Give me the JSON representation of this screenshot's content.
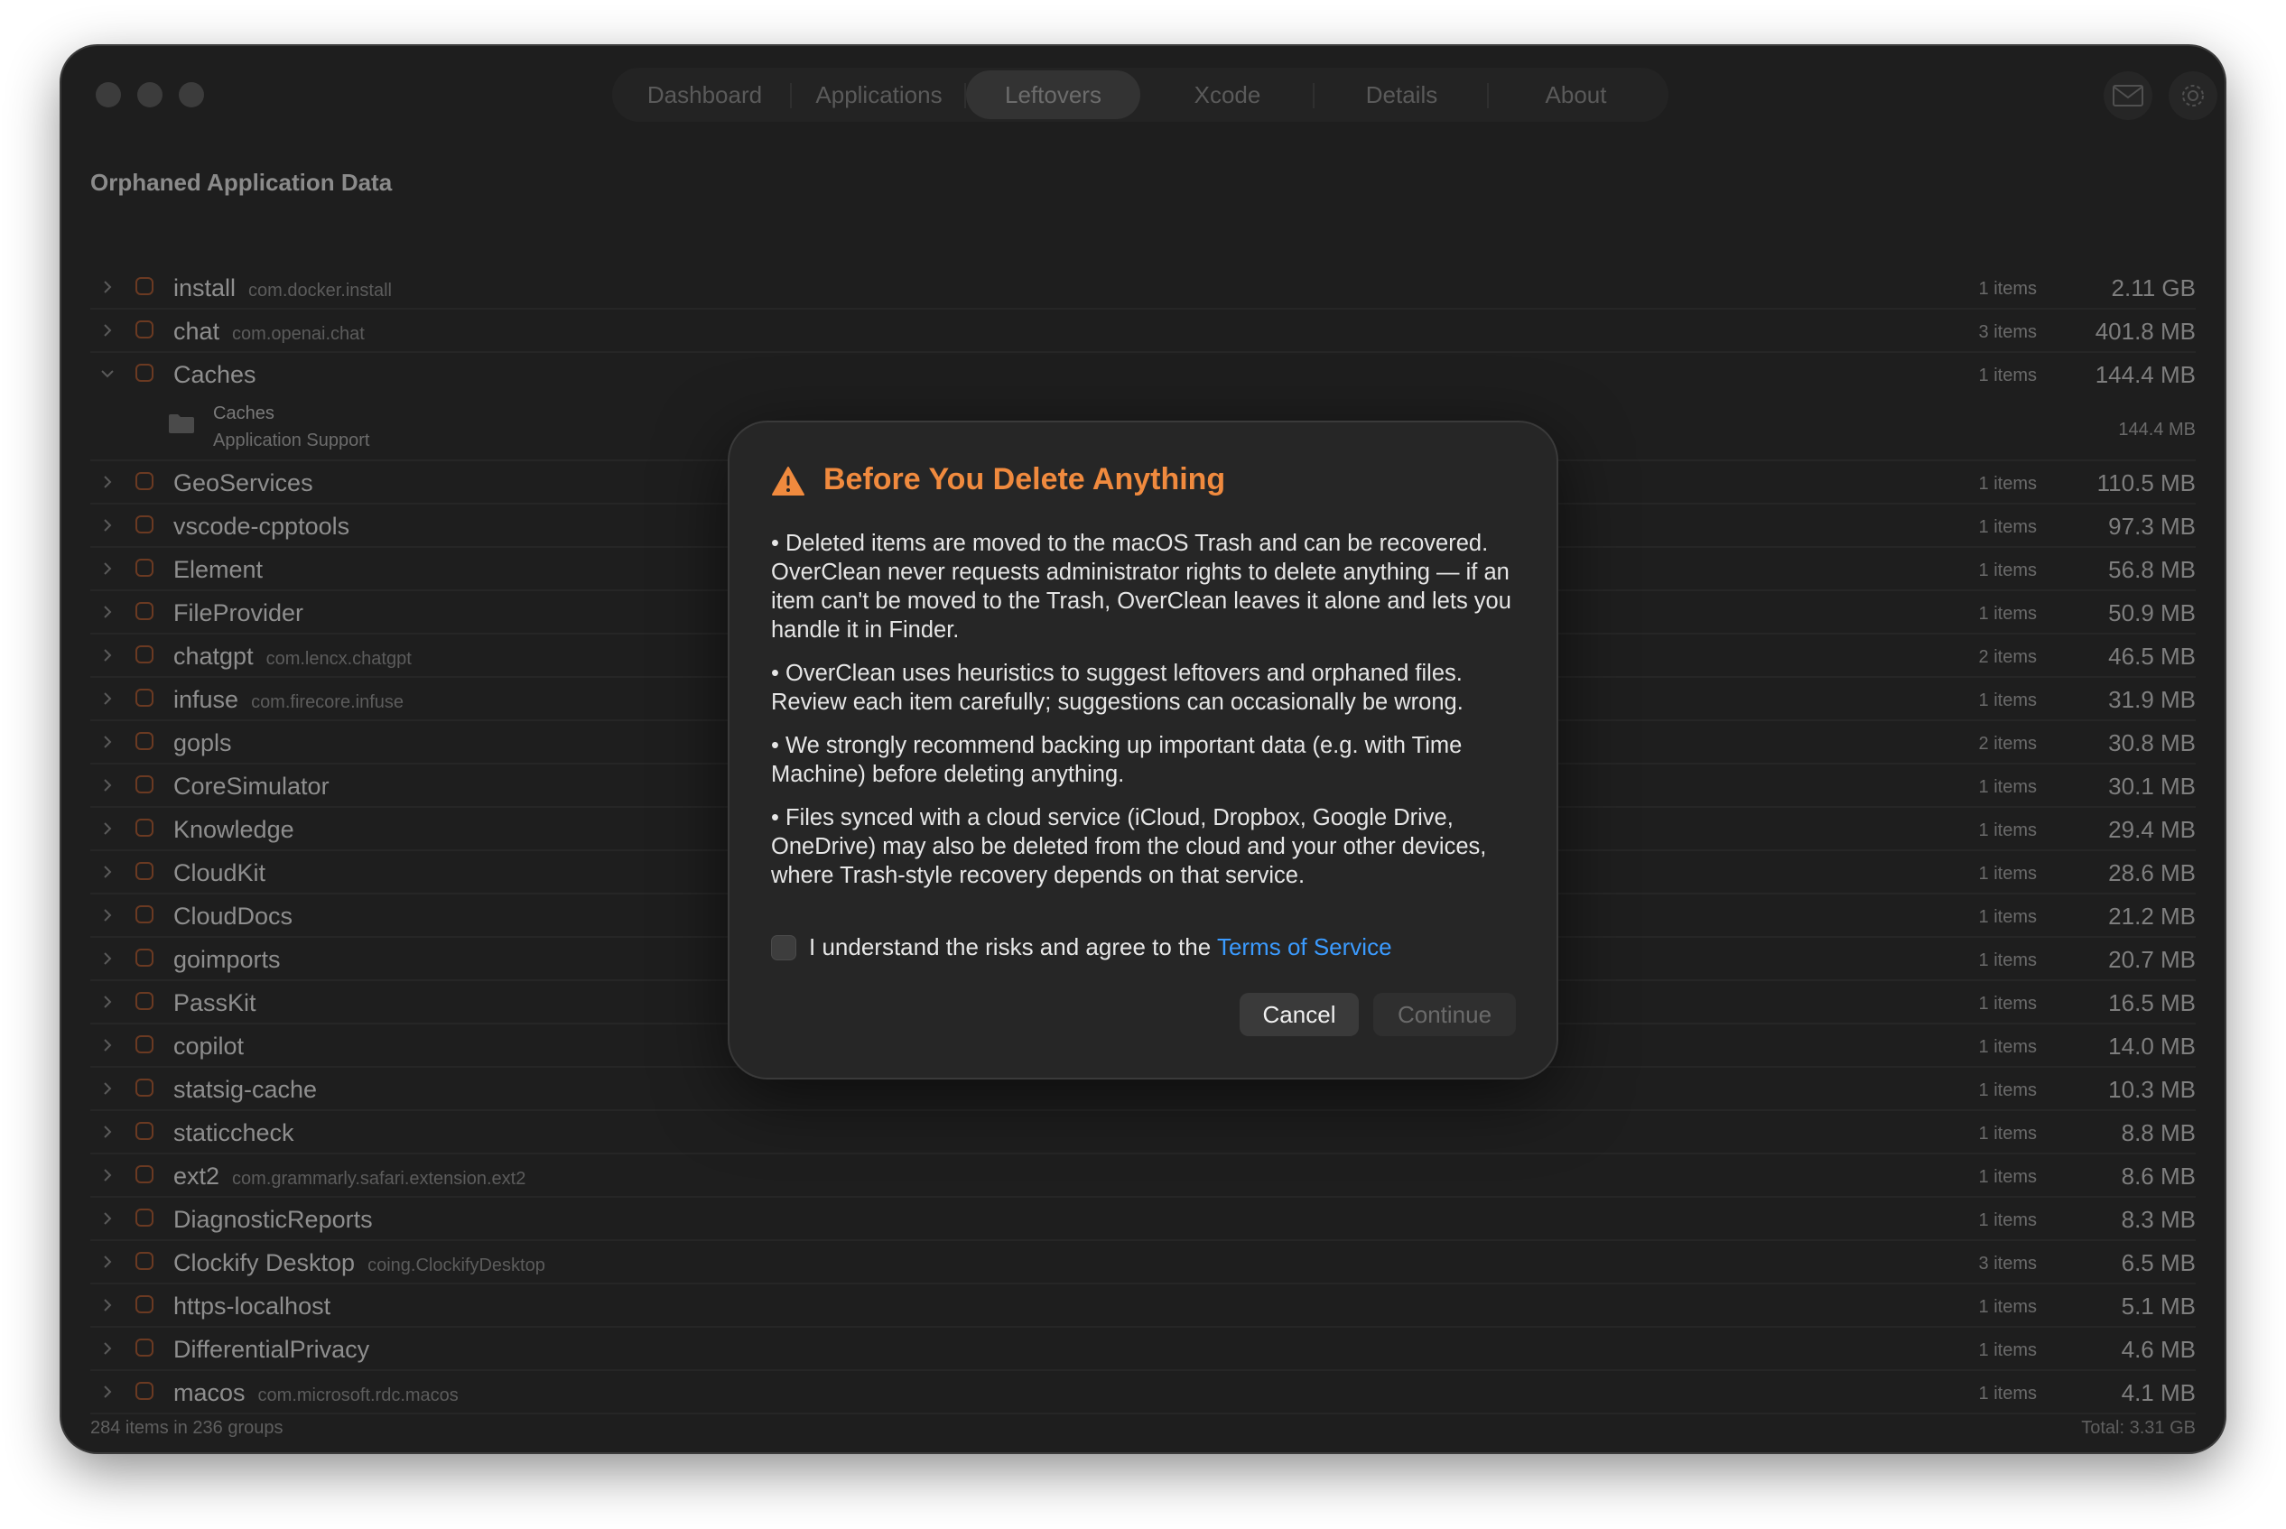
{
  "window": {
    "tabs": [
      {
        "label": "Dashboard"
      },
      {
        "label": "Applications"
      },
      {
        "label": "Leftovers"
      },
      {
        "label": "Xcode"
      },
      {
        "label": "Details"
      },
      {
        "label": "About"
      }
    ],
    "active_tab": "Leftovers",
    "header_icons": [
      "mail-icon",
      "gear-icon"
    ]
  },
  "section_title": "Orphaned Application Data",
  "rows": [
    {
      "name": "install",
      "bundle": "com.docker.install",
      "count": "1 items",
      "size": "2.11 GB"
    },
    {
      "name": "chat",
      "bundle": "com.openai.chat",
      "count": "3 items",
      "size": "401.8 MB"
    },
    {
      "name": "Caches",
      "bundle": "",
      "count": "1 items",
      "size": "144.4 MB",
      "expanded": true
    },
    {
      "name": "GeoServices",
      "bundle": "",
      "count": "1 items",
      "size": "110.5 MB"
    },
    {
      "name": "vscode-cpptools",
      "bundle": "",
      "count": "1 items",
      "size": "97.3 MB"
    },
    {
      "name": "Element",
      "bundle": "",
      "count": "1 items",
      "size": "56.8 MB"
    },
    {
      "name": "FileProvider",
      "bundle": "",
      "count": "1 items",
      "size": "50.9 MB"
    },
    {
      "name": "chatgpt",
      "bundle": "com.lencx.chatgpt",
      "count": "2 items",
      "size": "46.5 MB"
    },
    {
      "name": "infuse",
      "bundle": "com.firecore.infuse",
      "count": "1 items",
      "size": "31.9 MB"
    },
    {
      "name": "gopls",
      "bundle": "",
      "count": "2 items",
      "size": "30.8 MB"
    },
    {
      "name": "CoreSimulator",
      "bundle": "",
      "count": "1 items",
      "size": "30.1 MB"
    },
    {
      "name": "Knowledge",
      "bundle": "",
      "count": "1 items",
      "size": "29.4 MB"
    },
    {
      "name": "CloudKit",
      "bundle": "",
      "count": "1 items",
      "size": "28.6 MB"
    },
    {
      "name": "CloudDocs",
      "bundle": "",
      "count": "1 items",
      "size": "21.2 MB"
    },
    {
      "name": "goimports",
      "bundle": "",
      "count": "1 items",
      "size": "20.7 MB"
    },
    {
      "name": "PassKit",
      "bundle": "",
      "count": "1 items",
      "size": "16.5 MB"
    },
    {
      "name": "copilot",
      "bundle": "",
      "count": "1 items",
      "size": "14.0 MB"
    },
    {
      "name": "statsig-cache",
      "bundle": "",
      "count": "1 items",
      "size": "10.3 MB"
    },
    {
      "name": "staticcheck",
      "bundle": "",
      "count": "1 items",
      "size": "8.8 MB"
    },
    {
      "name": "ext2",
      "bundle": "com.grammarly.safari.extension.ext2",
      "count": "1 items",
      "size": "8.6 MB"
    },
    {
      "name": "DiagnosticReports",
      "bundle": "",
      "count": "1 items",
      "size": "8.3 MB"
    },
    {
      "name": "Clockify Desktop",
      "bundle": "coing.ClockifyDesktop",
      "count": "3 items",
      "size": "6.5 MB"
    },
    {
      "name": "https-localhost",
      "bundle": "",
      "count": "1 items",
      "size": "5.1 MB"
    },
    {
      "name": "DifferentialPrivacy",
      "bundle": "",
      "count": "1 items",
      "size": "4.6 MB"
    },
    {
      "name": "macos",
      "bundle": "com.microsoft.rdc.macos",
      "count": "1 items",
      "size": "4.1 MB"
    }
  ],
  "caches_child": {
    "name": "Caches",
    "path": "Application Support",
    "size": "144.4 MB"
  },
  "footer": {
    "summary": "284 items in 236 groups",
    "total": "Total: 3.31 GB"
  },
  "modal": {
    "title": "Before You Delete Anything",
    "bullets": [
      "• Deleted items are moved to the macOS Trash and can be recovered. OverClean never requests administrator rights to delete anything — if an item can't be moved to the Trash, OverClean leaves it alone and lets you handle it in Finder.",
      "• OverClean uses heuristics to suggest leftovers and orphaned files. Review each item carefully; suggestions can occasionally be wrong.",
      "• We strongly recommend backing up important data (e.g. with Time Machine) before deleting anything.",
      "• Files synced with a cloud service (iCloud, Dropbox, Google Drive, OneDrive) may also be deleted from the cloud and your other devices, where Trash-style recovery depends on that service."
    ],
    "agree_text": "I understand the risks and agree to the ",
    "agree_link": "Terms of Service",
    "agree_checked": false,
    "cancel_label": "Cancel",
    "continue_label": "Continue",
    "accent_color": "#f08a3e",
    "link_color": "#3b9bff"
  }
}
